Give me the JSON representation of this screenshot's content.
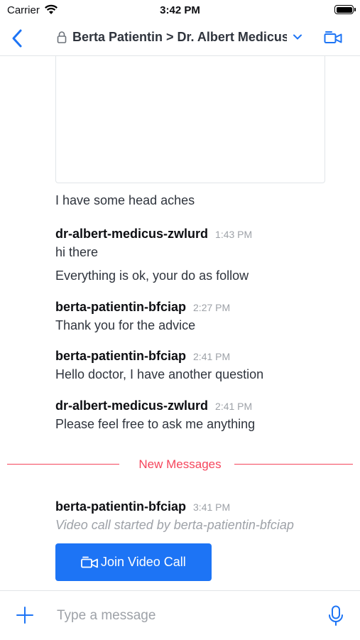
{
  "status_bar": {
    "carrier": "Carrier",
    "time": "3:42 PM"
  },
  "header": {
    "title": "Berta Patientin > Dr. Albert Medicus"
  },
  "messages": [
    {
      "text": "I have some head aches"
    },
    {
      "user": "dr-albert-medicus-zwlurd",
      "time": "1:43 PM",
      "text": "hi there"
    },
    {
      "text": "Everything is ok, your do as follow"
    },
    {
      "user": "berta-patientin-bfciap",
      "time": "2:27 PM",
      "text": "Thank you for the advice"
    },
    {
      "user": "berta-patientin-bfciap",
      "time": "2:41 PM",
      "text": "Hello doctor, I have another question"
    },
    {
      "user": "dr-albert-medicus-zwlurd",
      "time": "2:41 PM",
      "text": "Please feel free to ask me anything"
    },
    {
      "user": "berta-patientin-bfciap",
      "time": "3:41 PM",
      "text": "Video call started by berta-patientin-bfciap"
    }
  ],
  "separator": {
    "label": "New Messages"
  },
  "video_call": {
    "join_label": "Join Video Call"
  },
  "composer": {
    "placeholder": "Type a message"
  },
  "colors": {
    "accent": "#1d74f5",
    "new_messages": "#f5455c",
    "muted": "#9ea2a8"
  },
  "icons": [
    "wifi-icon",
    "battery-icon",
    "back-chevron-icon",
    "lock-icon",
    "chevron-down-icon",
    "video-camera-icon",
    "plus-icon",
    "microphone-icon"
  ]
}
